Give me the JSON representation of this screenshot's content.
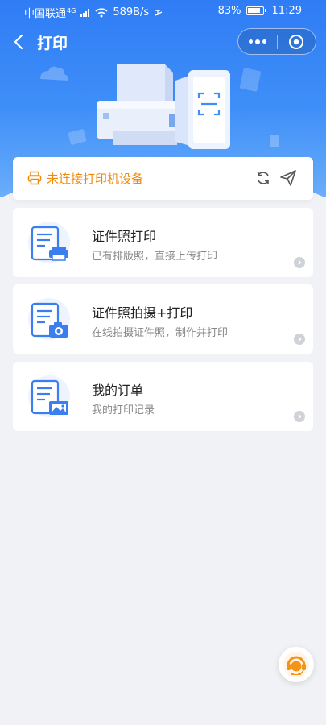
{
  "status_bar": {
    "carrier": "中国联通",
    "network_type": "4G",
    "speed": "589B/s",
    "battery": "83%",
    "time": "11:29"
  },
  "nav": {
    "title": "打印",
    "more_icon": "more-dots-icon",
    "close_icon": "target-close-icon"
  },
  "printer_status": {
    "text": "未连接打印机设备",
    "color": "#f08a0c",
    "refresh_icon": "refresh-icon",
    "send_icon": "paper-plane-icon"
  },
  "menu": [
    {
      "title": "证件照打印",
      "subtitle": "已有排版照，直接上传打印",
      "icon": "document-printer-icon"
    },
    {
      "title": "证件照拍摄+打印",
      "subtitle": "在线拍摄证件照，制作并打印",
      "icon": "document-camera-icon"
    },
    {
      "title": "我的订单",
      "subtitle": "我的打印记录",
      "icon": "document-image-icon"
    }
  ],
  "colors": {
    "primary": "#2f7cf5",
    "accent_orange": "#f08a0c",
    "background": "#f0f2f5"
  }
}
